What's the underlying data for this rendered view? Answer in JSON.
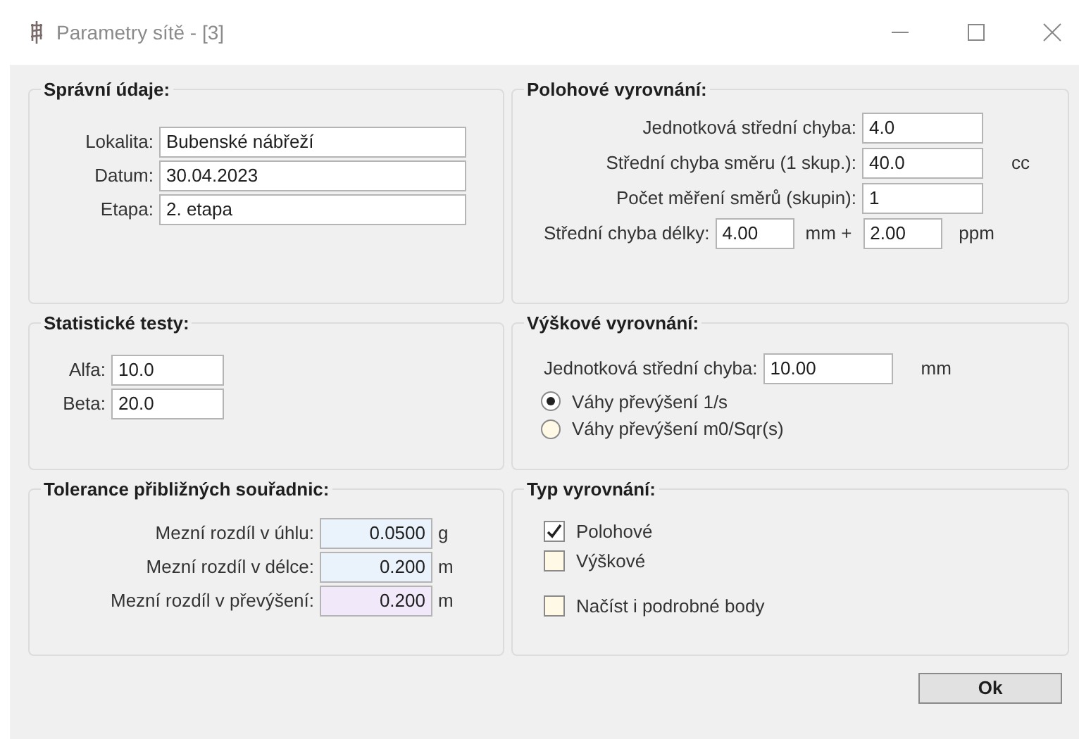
{
  "window": {
    "title": "Parametry sítě - [3]"
  },
  "admin": {
    "title": "Správní údaje:",
    "fields": [
      {
        "label": "Lokalita:",
        "value": "Bubenské nábřeží"
      },
      {
        "label": "Datum:",
        "value": "30.04.2023"
      },
      {
        "label": "Etapa:",
        "value": "2. etapa"
      }
    ]
  },
  "position": {
    "title": "Polohové vyrovnání:",
    "rows": [
      {
        "label": "Jednotková střední chyba:",
        "value": "4.0"
      },
      {
        "label": "Střední chyba směru (1 skup.):",
        "value": "40.0",
        "unit": "cc"
      },
      {
        "label": "Počet měření směrů (skupin):",
        "value": "1"
      }
    ],
    "length": {
      "label": "Střední chyba délky:",
      "value": "4.00",
      "unit": "mm +",
      "value2": "2.00",
      "unit2": "ppm"
    }
  },
  "stats": {
    "title": "Statistické testy:",
    "fields": [
      {
        "label": "Alfa:",
        "value": "10.0"
      },
      {
        "label": "Beta:",
        "value": "20.0"
      }
    ]
  },
  "height": {
    "title": "Výškové vyrovnání:",
    "label": "Jednotková střední chyba:",
    "value": "10.00",
    "unit": "mm",
    "options": [
      {
        "label": "Váhy převýšení 1/s",
        "selected": true
      },
      {
        "label": "Váhy převýšení m0/Sqr(s)",
        "selected": false
      }
    ]
  },
  "tolerance": {
    "title": "Tolerance přibližných souřadnic:",
    "fields": [
      {
        "label": "Mezní rozdíl v úhlu:",
        "value": "0.0500",
        "unit": "g",
        "color": "#eaf2fc"
      },
      {
        "label": "Mezní rozdíl v délce:",
        "value": "0.200",
        "unit": "m",
        "color": "#eaf2fc"
      },
      {
        "label": "Mezní rozdíl v převýšení:",
        "value": "0.200",
        "unit": "m",
        "color": "#f1e9f9"
      }
    ]
  },
  "type": {
    "title": "Typ vyrovnání:",
    "options": [
      {
        "label": "Polohové",
        "checked": true
      },
      {
        "label": "Výškové",
        "checked": false
      }
    ],
    "extra": {
      "label": "Načíst i podrobné body",
      "checked": false
    }
  },
  "buttons": [
    "Ok"
  ]
}
